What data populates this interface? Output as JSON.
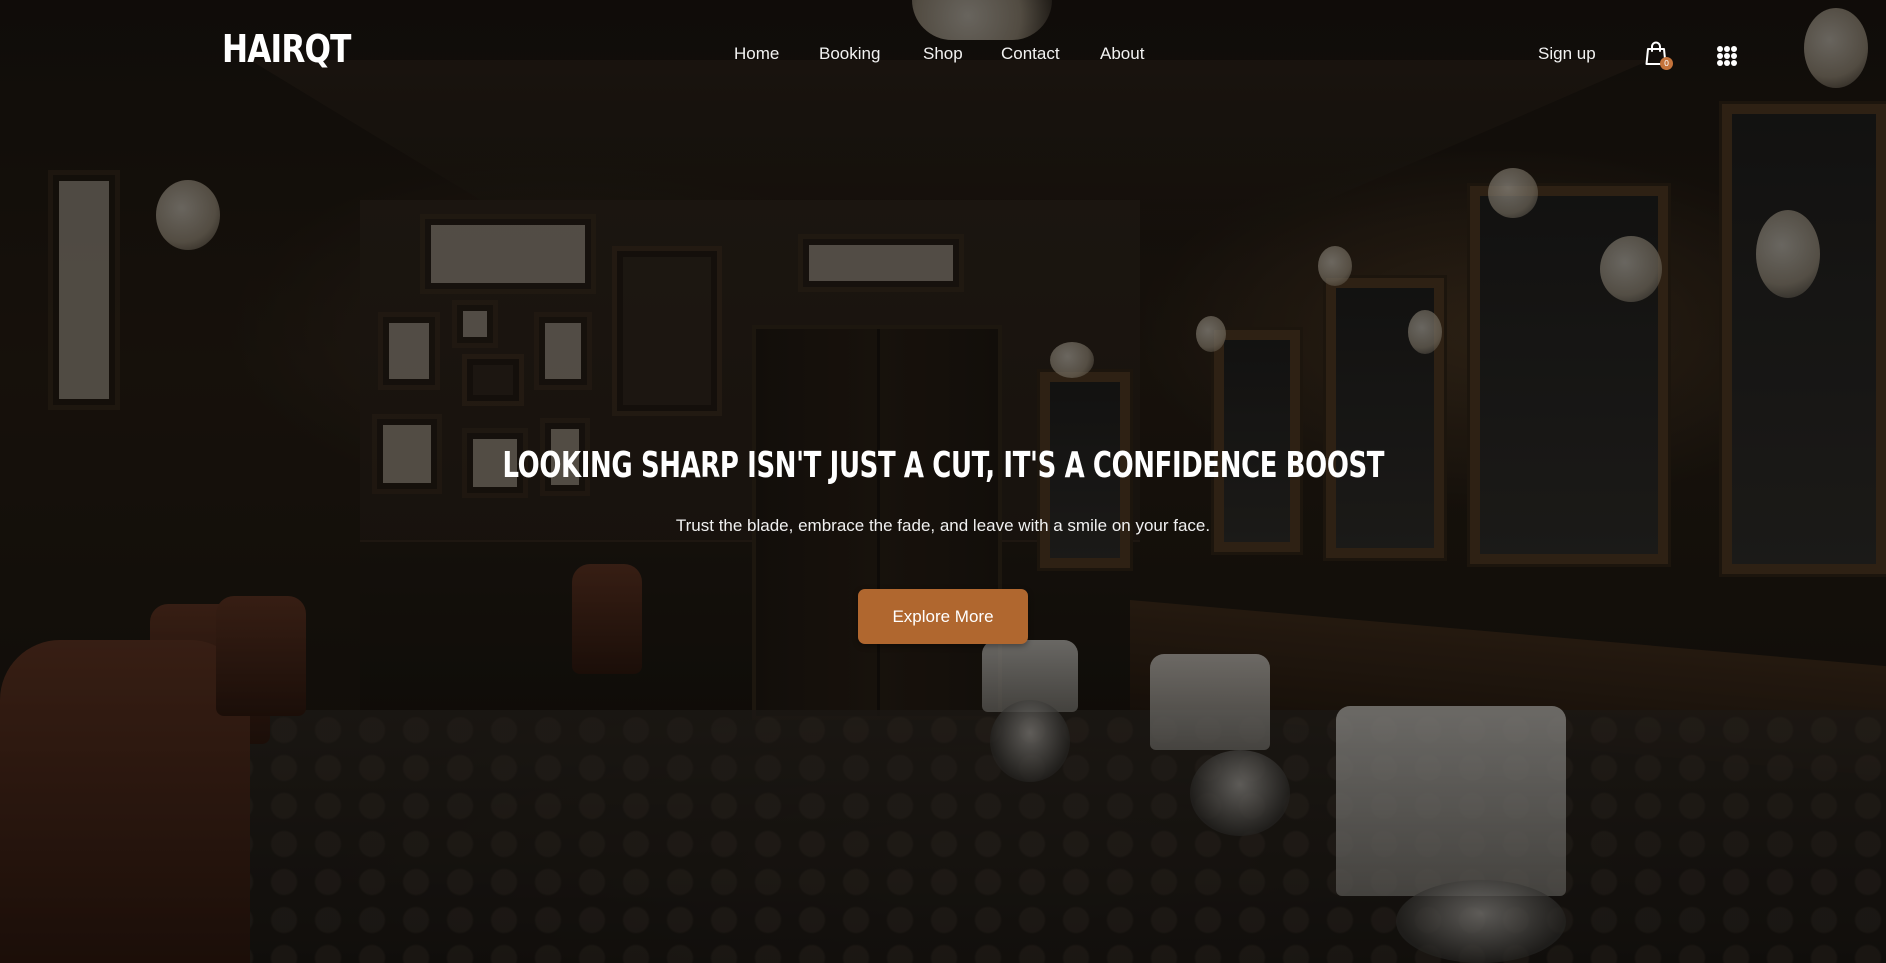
{
  "brand": {
    "logo_text": "HAIRQT"
  },
  "nav": {
    "items": [
      {
        "label": "Home"
      },
      {
        "label": "Booking"
      },
      {
        "label": "Shop"
      },
      {
        "label": "Contact"
      },
      {
        "label": "About"
      }
    ]
  },
  "header_actions": {
    "signup_label": "Sign up",
    "cart_count": "0",
    "cart_icon": "shopping-bag-icon",
    "menu_icon": "grid-menu-icon"
  },
  "hero": {
    "headline": "LOOKING SHARP ISN'T JUST A CUT, IT'S A CONFIDENCE BOOST",
    "subheadline": "Trust the blade, embrace the fade, and leave with a smile on your face.",
    "cta_label": "Explore More"
  },
  "colors": {
    "accent": "#b0672f",
    "badge": "#c4733b",
    "text": "#ffffff"
  }
}
